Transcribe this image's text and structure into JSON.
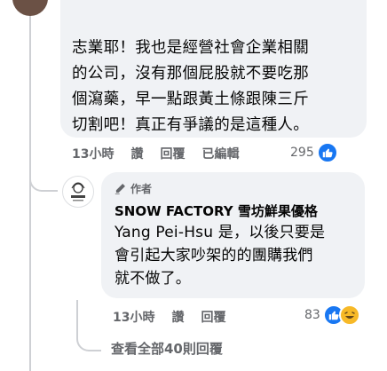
{
  "main_comment": {
    "lines": [
      "志業耶！我也是經營社會企業相關",
      "的公司，沒有那個屁股就不要吃那",
      "個瀉藥，早一點跟黃土條跟陳三斤",
      "切割吧！真正有爭議的是這種人。"
    ],
    "time": "13小時",
    "like_label": "讚",
    "reply_label": "回覆",
    "edited_label": "已編輯",
    "reaction_count": "295"
  },
  "reply": {
    "author_badge": "作者",
    "author_name": "SNOW FACTORY 雪坊鮮果優格",
    "lines": [
      "Yang Pei-Hsu 是，以後只要是",
      "會引起大家吵架的的團購我們",
      "就不做了。"
    ],
    "time": "13小時",
    "like_label": "讚",
    "reply_label": "回覆",
    "reaction_count": "83"
  },
  "view_all_replies": "查看全部40則回覆",
  "icons": {
    "like": "like-icon",
    "haha": "haha-icon",
    "pencil": "pencil-icon",
    "logo": "snow-factory-logo-icon"
  },
  "colors": {
    "bubble": "#f0f2f5",
    "secondary_text": "#65676b",
    "like_blue": "#1877f2",
    "haha_yellow": "#f7b928",
    "thread_line": "#ced0d4"
  }
}
